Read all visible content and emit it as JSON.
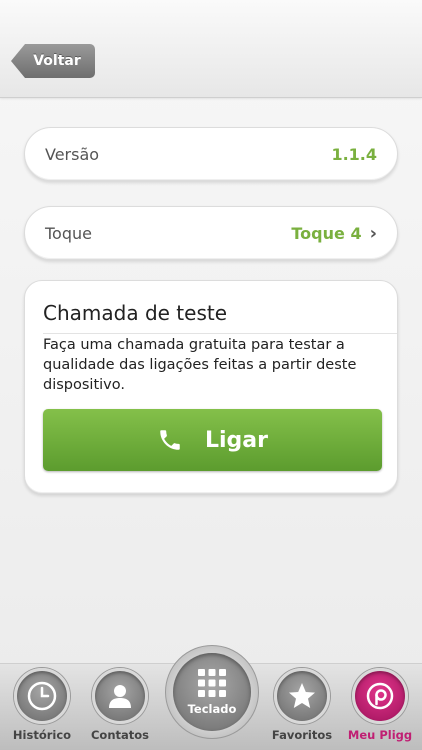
{
  "header": {
    "back_label": "Voltar"
  },
  "settings": {
    "version": {
      "label": "Versão",
      "value": "1.1.4"
    },
    "ringtone": {
      "label": "Toque",
      "value": "Toque 4"
    }
  },
  "test_call": {
    "title": "Chamada de teste",
    "description": "Faça uma chamada gratuita para testar a qualidade das ligações feitas a partir deste dispositivo.",
    "button_label": "Ligar"
  },
  "tabbar": {
    "items": [
      {
        "label": "Histórico",
        "icon": "clock-icon"
      },
      {
        "label": "Contatos",
        "icon": "person-icon"
      },
      {
        "label": "Teclado",
        "icon": "keypad-icon"
      },
      {
        "label": "Favoritos",
        "icon": "star-icon"
      },
      {
        "label": "Meu Pligg",
        "icon": "pligg-logo-icon"
      }
    ],
    "active_index": 4
  },
  "colors": {
    "accent_green": "#7ab03f",
    "active_pink": "#c01f73"
  }
}
